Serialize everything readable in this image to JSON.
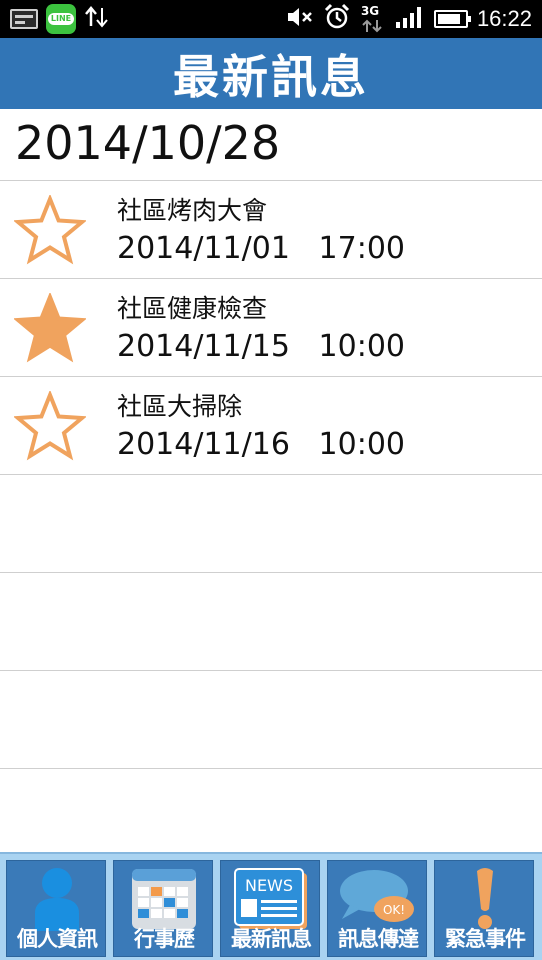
{
  "status_bar": {
    "time": "16:22",
    "line_label": "LINE",
    "network_label": "3G",
    "battery_level": 0.85,
    "icons": [
      "sim-card-icon",
      "line-app-icon",
      "data-arrows-icon",
      "mute-icon",
      "alarm-icon",
      "network-3g-icon",
      "signal-icon",
      "battery-icon"
    ]
  },
  "header": {
    "title": "最新訊息"
  },
  "date_header": "2014/10/28",
  "events": [
    {
      "name": "社區烤肉大會",
      "date": "2014/11/01",
      "time": "17:00",
      "starred": false
    },
    {
      "name": "社區健康檢查",
      "date": "2014/11/15",
      "time": "10:00",
      "starred": true
    },
    {
      "name": "社區大掃除",
      "date": "2014/11/16",
      "time": "10:00",
      "starred": false
    }
  ],
  "empty_rows": 4,
  "nav": [
    {
      "label": "個人資訊",
      "icon": "person-icon"
    },
    {
      "label": "行事歷",
      "icon": "calendar-icon"
    },
    {
      "label": "最新訊息",
      "icon": "news-icon",
      "badge": "NEWS"
    },
    {
      "label": "訊息傳達",
      "icon": "chat-bubble-icon",
      "badge": "OK!"
    },
    {
      "label": "緊急事件",
      "icon": "exclamation-icon"
    }
  ],
  "colors": {
    "title_bar": "#3175b6",
    "star": "#f0a35e",
    "nav_bg": "#a9d3f1",
    "nav_tile": "#3a7ab8"
  }
}
